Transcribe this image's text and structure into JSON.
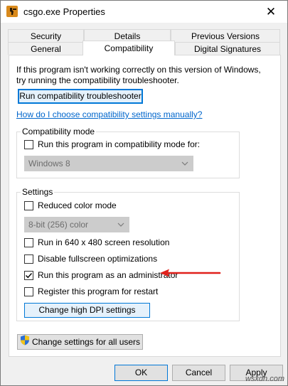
{
  "window": {
    "title": "csgo.exe Properties",
    "close_glyph": "✕"
  },
  "tabs": {
    "row1": [
      "Security",
      "Details",
      "Previous Versions"
    ],
    "row2": [
      "General",
      "Compatibility",
      "Digital Signatures"
    ],
    "active": "Compatibility"
  },
  "intro": {
    "line1": "If this program isn't working correctly on this version of Windows,",
    "line2": "try running the compatibility troubleshooter."
  },
  "troubleshooter_button": "Run compatibility troubleshooter",
  "help_link": "How do I choose compatibility settings manually?",
  "compat_mode": {
    "label": "Compatibility mode",
    "checkbox_label": "Run this program in compatibility mode for:",
    "checked": false,
    "dropdown_value": "Windows 8"
  },
  "settings": {
    "label": "Settings",
    "reduced_color": {
      "label": "Reduced color mode",
      "checked": false
    },
    "color_dropdown_value": "8-bit (256) color",
    "run_640": {
      "label": "Run in 640 x 480 screen resolution",
      "checked": false
    },
    "disable_fullscreen": {
      "label": "Disable fullscreen optimizations",
      "checked": false
    },
    "run_admin": {
      "label": "Run this program as an administrator",
      "checked": true
    },
    "register_restart": {
      "label": "Register this program for restart",
      "checked": false
    },
    "dpi_button": "Change high DPI settings"
  },
  "all_users_button": "Change settings for all users",
  "dialog_buttons": {
    "ok": "OK",
    "cancel": "Cancel",
    "apply": "Apply"
  },
  "watermark": "wsxdn.com",
  "colors": {
    "annotation_arrow": "#e0201b",
    "link": "#0066cc",
    "focus": "#0078d7"
  }
}
